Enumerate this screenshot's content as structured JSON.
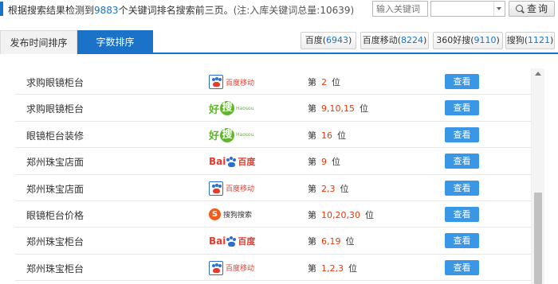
{
  "summary": {
    "prefix": "根据搜索结果检测到",
    "count": "9883",
    "suffix": "个关键词排名搜索前三页。",
    "note": "(注:入库关键词总量:10639)"
  },
  "search": {
    "placeholder": "输入关键词",
    "select_value": "",
    "button_label": "查询"
  },
  "tabs": [
    {
      "label": "发布时间排序",
      "active": false
    },
    {
      "label": "字数排序",
      "active": true
    }
  ],
  "engines": [
    {
      "name": "百度",
      "count": "6943"
    },
    {
      "name": "百度移动",
      "count": "8224"
    },
    {
      "name": "360好搜",
      "count": "9110"
    },
    {
      "name": "搜狗",
      "count": "1121"
    }
  ],
  "logo_text": {
    "baidu_mobile": "百度移动",
    "haosou_hao": "好",
    "haosou_sou": "搜",
    "haosou_latin": "Haosou",
    "baidu_bai": "Bai",
    "baidu_zh": "百度",
    "sogou_s": "S",
    "sogou_text": "搜狗搜索"
  },
  "rank_prefix": "第",
  "rank_suffix": "位",
  "view_label": "查看",
  "rows": [
    {
      "keyword": "求购眼镜柜台",
      "engine": "baidu_mobile",
      "positions": "2"
    },
    {
      "keyword": "求购眼镜柜台",
      "engine": "haosou",
      "positions": "9,10,15"
    },
    {
      "keyword": "眼镜柜台装修",
      "engine": "haosou",
      "positions": "16"
    },
    {
      "keyword": "郑州珠宝店面",
      "engine": "baidu",
      "positions": "9"
    },
    {
      "keyword": "郑州珠宝店面",
      "engine": "baidu_mobile",
      "positions": "2,3"
    },
    {
      "keyword": "眼镜柜台价格",
      "engine": "sogou",
      "positions": "10,20,30"
    },
    {
      "keyword": "郑州珠宝柜台",
      "engine": "baidu",
      "positions": "6,19"
    },
    {
      "keyword": "郑州珠宝柜台",
      "engine": "baidu_mobile",
      "positions": "1,2,3"
    }
  ]
}
